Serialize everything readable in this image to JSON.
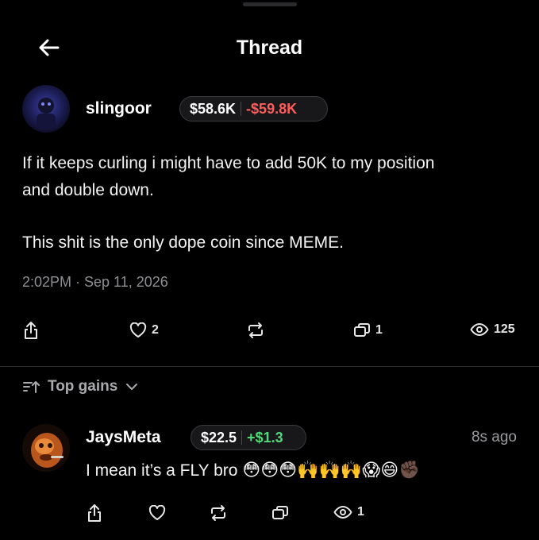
{
  "header": {
    "title": "Thread"
  },
  "post": {
    "username": "slingoor",
    "stat_a": "$58.6K",
    "stat_b": "-$59.8K",
    "text_line1": "If it keeps curling i might have to add 50K to my position",
    "text_line2": "and double down.",
    "text_line3": "This shit is the only dope coin since MEME.",
    "timestamp": "2:02PM · Sep 11, 2026",
    "likes": "2",
    "replies": "1",
    "views": "125"
  },
  "sort": {
    "label": "Top gains"
  },
  "reply": {
    "username": "JaysMeta",
    "stat_a": "$22.5",
    "stat_b": "+$1.3",
    "time": "8s ago",
    "text": "I mean it’s a FLY bro",
    "emojis": "😳😳😳🙌🙌🙌😱😄✊🏿",
    "views": "1"
  },
  "colors": {
    "background": "#000000",
    "negative": "#ff5c5c",
    "positive": "#4fd97a",
    "muted": "#8e8e93"
  }
}
